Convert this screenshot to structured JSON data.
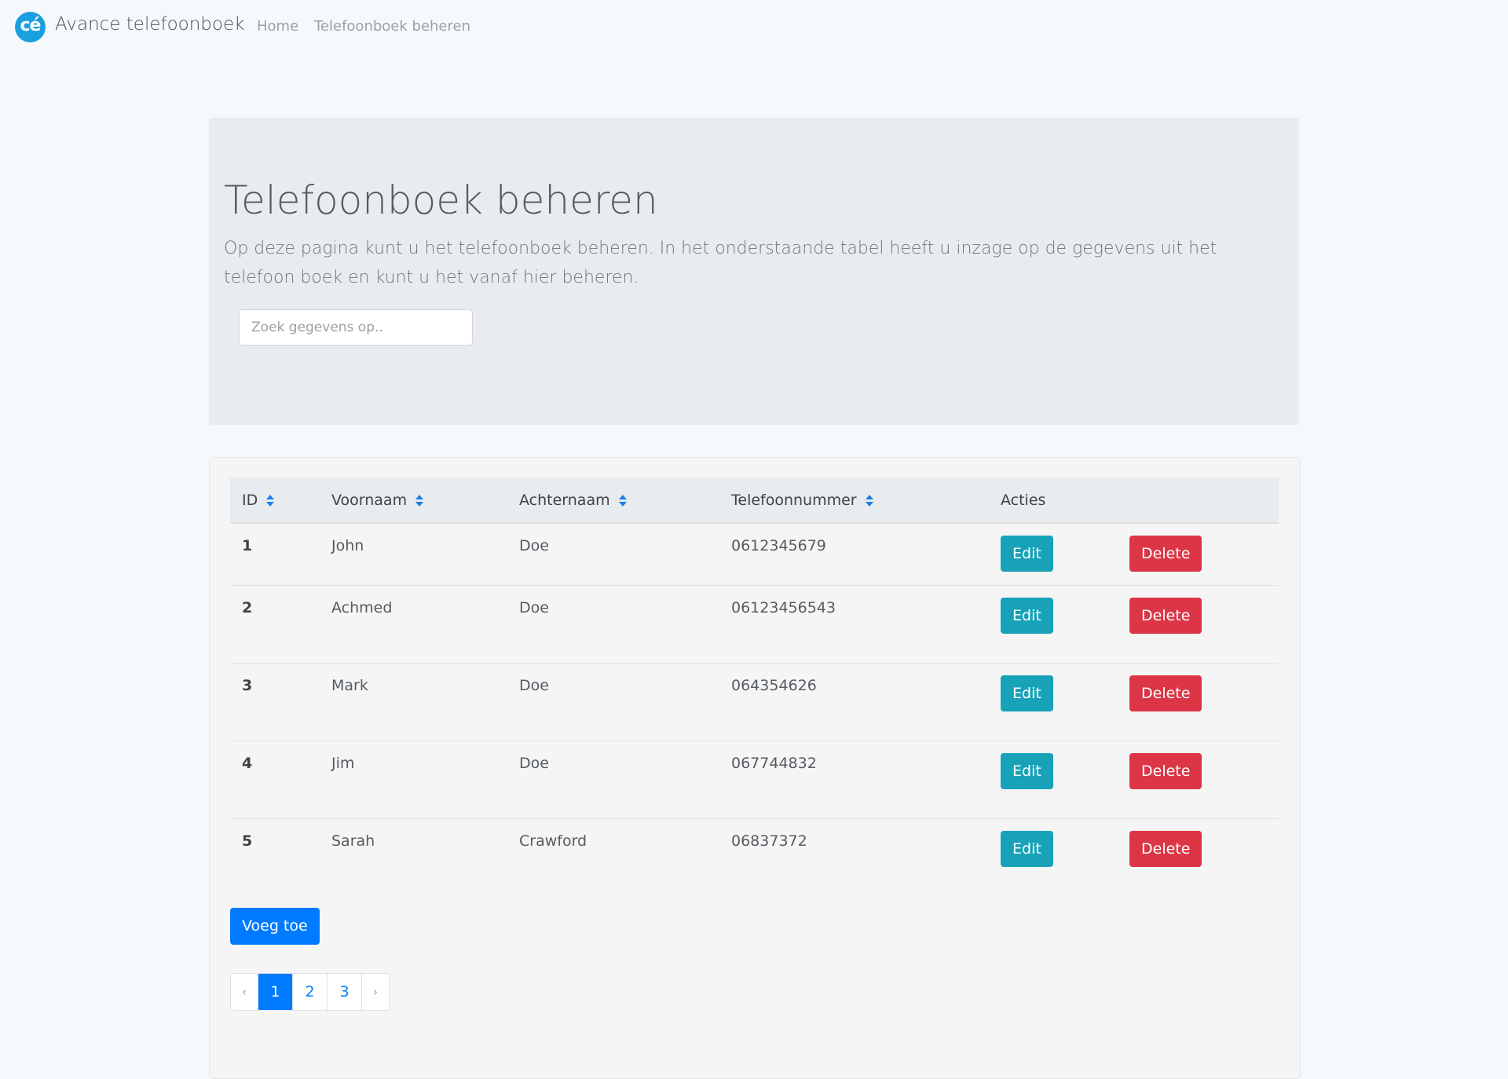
{
  "navbar": {
    "logo_text": "cé",
    "brand": "Avance telefoonboek",
    "links": [
      {
        "label": "Home"
      },
      {
        "label": "Telefoonboek beheren"
      }
    ]
  },
  "jumbotron": {
    "title": "Telefoonboek beheren",
    "lead": "Op deze pagina kunt u het telefoonboek beheren. In het onderstaande tabel heeft u inzage op de gegevens uit het telefoon boek en kunt u het vanaf hier beheren.",
    "search_placeholder": "Zoek gegevens op.."
  },
  "table": {
    "headers": {
      "id": "ID",
      "firstname": "Voornaam",
      "lastname": "Achternaam",
      "phone": "Telefoonnummer",
      "actions": "Acties"
    },
    "rows": [
      {
        "id": "1",
        "firstname": "John",
        "lastname": "Doe",
        "phone": "0612345679"
      },
      {
        "id": "2",
        "firstname": "Achmed",
        "lastname": "Doe",
        "phone": "06123456543"
      },
      {
        "id": "3",
        "firstname": "Mark",
        "lastname": "Doe",
        "phone": "064354626"
      },
      {
        "id": "4",
        "firstname": "Jim",
        "lastname": "Doe",
        "phone": "067744832"
      },
      {
        "id": "5",
        "firstname": "Sarah",
        "lastname": "Crawford",
        "phone": "06837372"
      }
    ],
    "edit_label": "Edit",
    "delete_label": "Delete"
  },
  "add_button_label": "Voeg toe",
  "pagination": {
    "prev": "‹",
    "next": "›",
    "pages": [
      "1",
      "2",
      "3"
    ],
    "active_page": "1"
  },
  "colors": {
    "primary": "#007bff",
    "info": "#17a2b8",
    "danger": "#dc3545",
    "logo": "#1a9fe0"
  }
}
